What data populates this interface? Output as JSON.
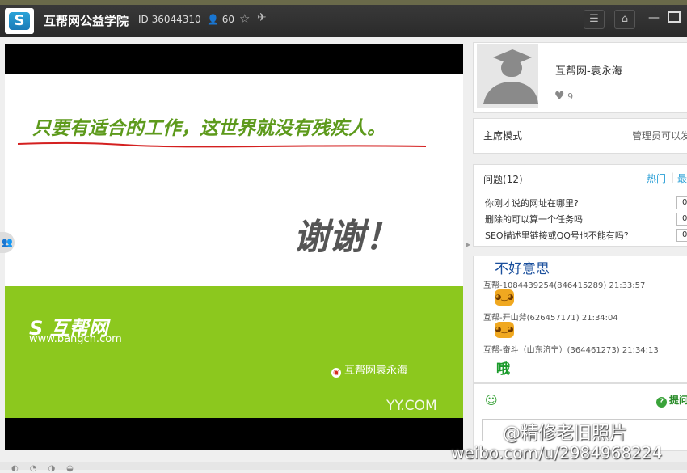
{
  "window": {
    "title": "互帮网公益学院",
    "channel_id": "ID 36044310",
    "user_count": "60"
  },
  "slide": {
    "motto": "只要有适合的工作，这世界就没有残疾人。",
    "thanks": "谢谢！",
    "brand_name": "互帮网",
    "brand_url": "www.bangcn.com",
    "weibo_name": "互帮网袁永海",
    "yy_logo": "YY.COM"
  },
  "host": {
    "name": "互帮网-袁永海",
    "likes": "9"
  },
  "mode": {
    "label": "主席模式",
    "value": "管理员可以发"
  },
  "questions": {
    "title": "问题(12)",
    "tab_hot": "热门",
    "tab_latest": "最",
    "items": [
      {
        "text": "你刚才说的网址在哪里?",
        "count": "0"
      },
      {
        "text": "删除的可以算一个任务吗",
        "count": "0"
      },
      {
        "text": "SEO描述里链接或QQ号也不能有吗?",
        "count": "0"
      }
    ]
  },
  "chat": {
    "messages": [
      {
        "text": "不好意思"
      },
      {
        "sender": "互帮-1084439254(846415289) 21:33:57"
      },
      {
        "sender": "互帮-开山斧(626457171) 21:34:04"
      },
      {
        "sender": "互帮-奋斗（山东济宁）(364461273) 21:34:13"
      },
      {
        "text": "哦"
      }
    ],
    "ask_label": "提问"
  },
  "watermark": {
    "line1": "@精修老旧照片",
    "line2": "weibo.com/u/2984968224"
  },
  "icons": [
    "s-logo-icon",
    "user-icon",
    "star-icon",
    "plane-icon",
    "list-icon",
    "home-icon",
    "minimize-icon",
    "maximize-icon",
    "people-icon",
    "heart-icon",
    "smiley-icon",
    "question-icon"
  ],
  "colors": {
    "titlebar": "#2f2f2f",
    "slide_green": "#8cc81e",
    "motto_green": "#5d9a1c",
    "link_blue": "#2a9fd6"
  }
}
